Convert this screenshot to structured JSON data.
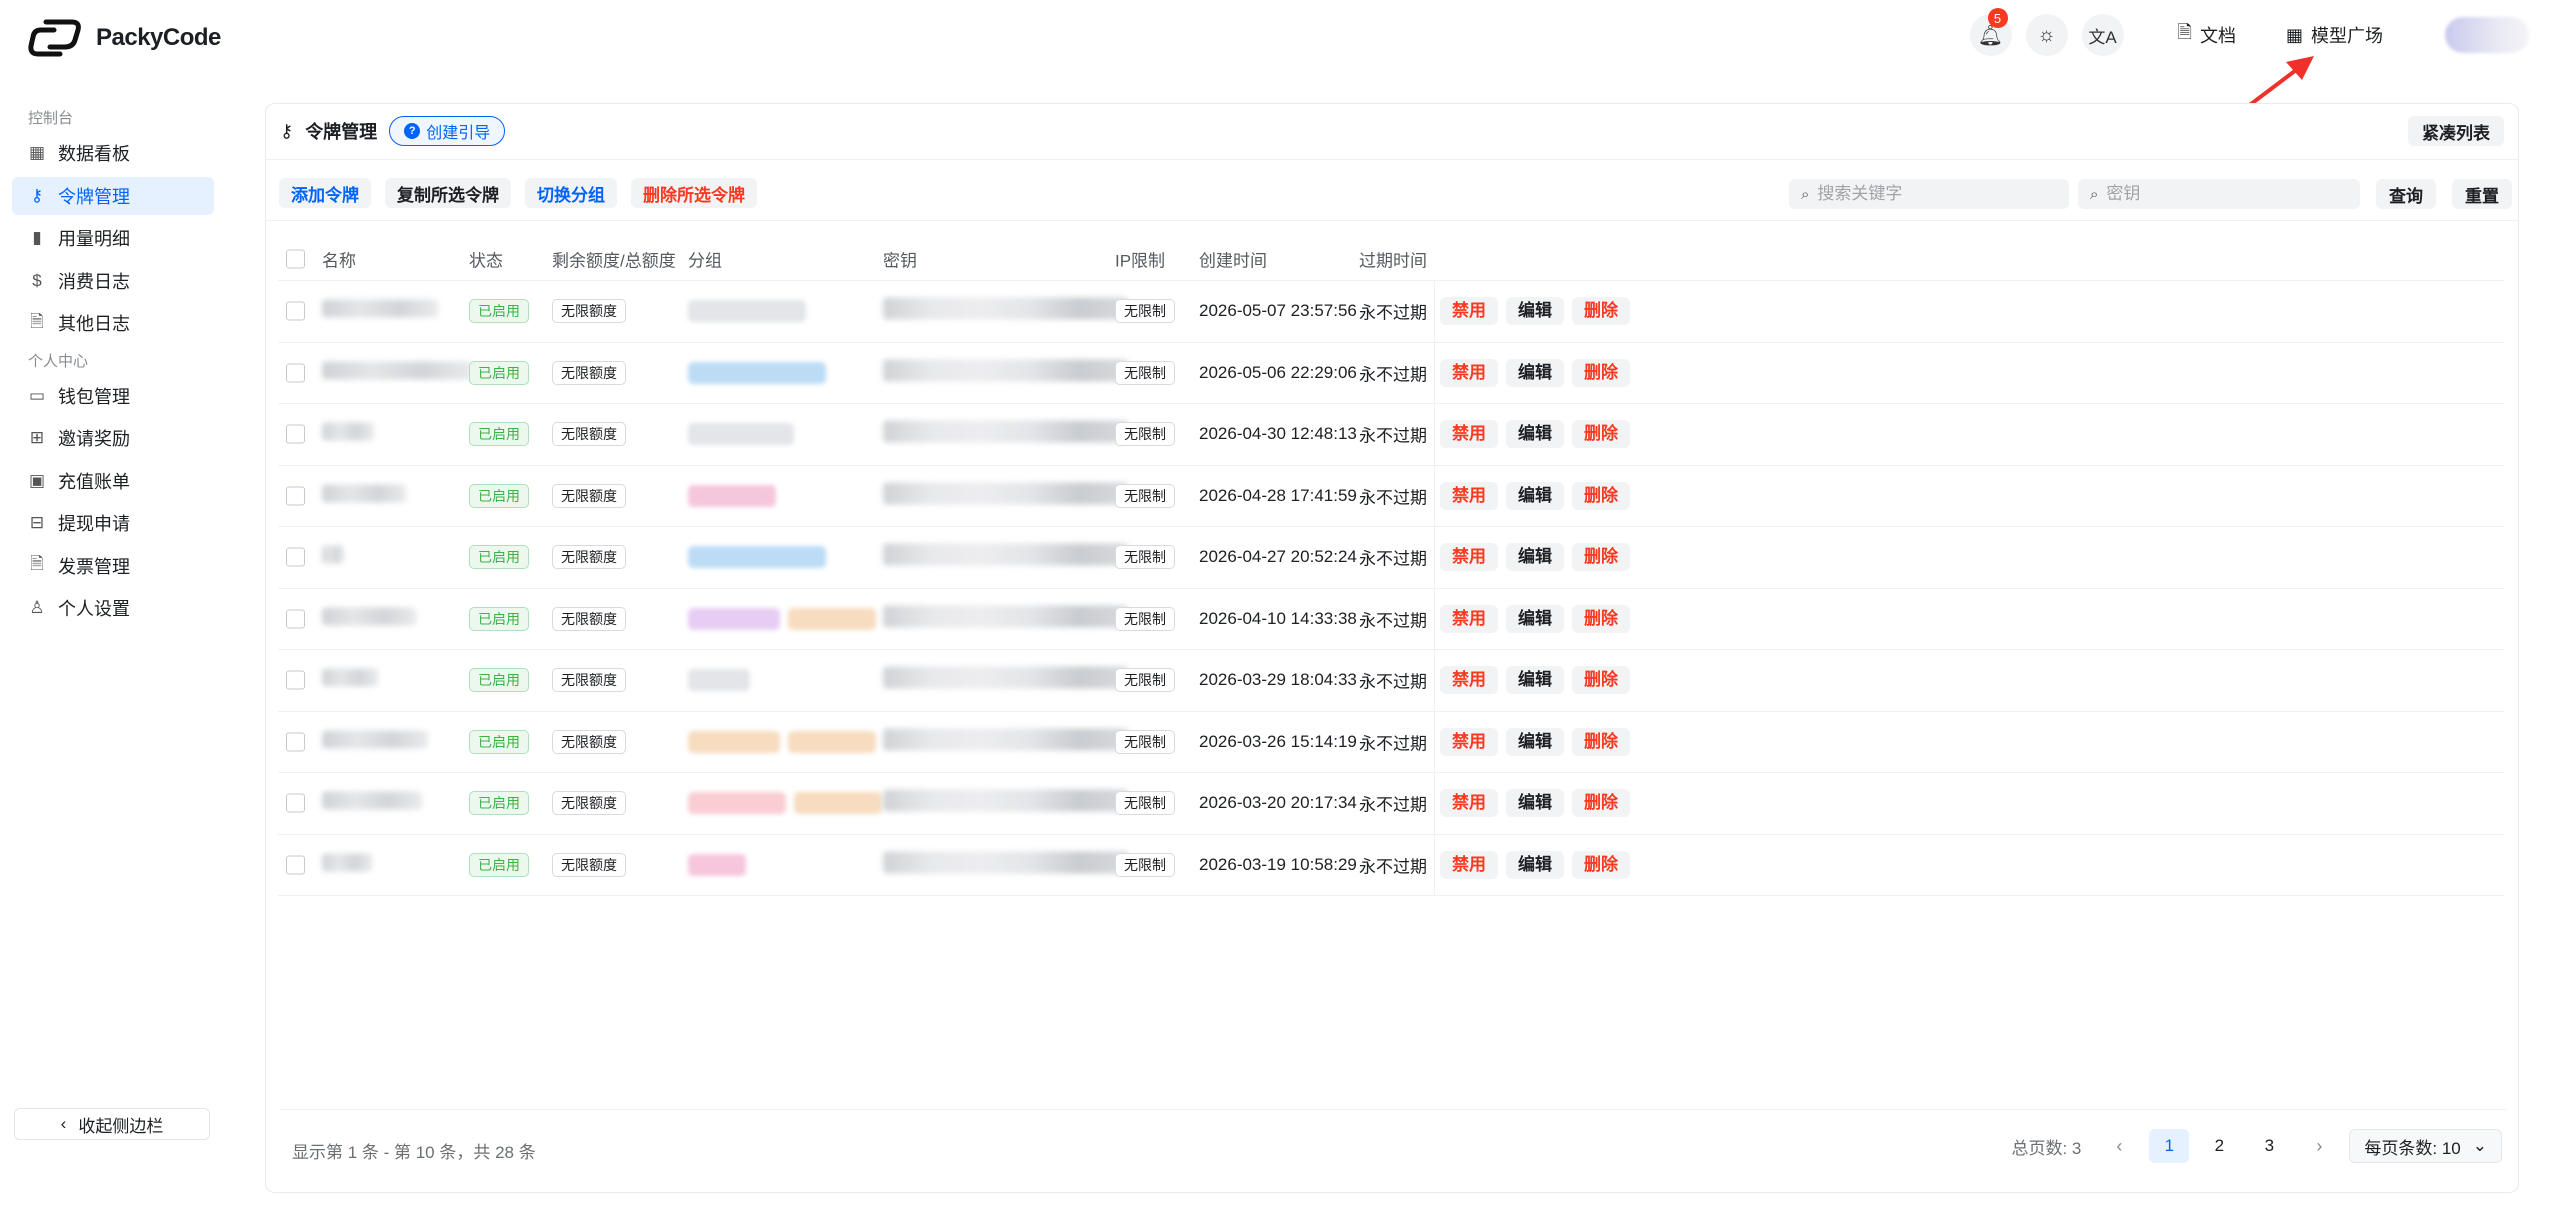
{
  "header": {
    "logo_text": "PackyCode",
    "notification_count": "5",
    "docs_label": "文档",
    "models_label": "模型广场",
    "brand_color": "#0064fa"
  },
  "sidebar": {
    "section1": "控制台",
    "section2": "个人中心",
    "items": [
      {
        "label": "数据看板",
        "icon": "dashboard-icon"
      },
      {
        "label": "令牌管理",
        "icon": "key-icon"
      },
      {
        "label": "用量明细",
        "icon": "bar-chart-icon"
      },
      {
        "label": "消费日志",
        "icon": "receipt-icon"
      },
      {
        "label": "其他日志",
        "icon": "document-icon"
      },
      {
        "label": "钱包管理",
        "icon": "wallet-icon"
      },
      {
        "label": "邀请奖励",
        "icon": "gift-icon"
      },
      {
        "label": "充值账单",
        "icon": "calendar-icon"
      },
      {
        "label": "提现申请",
        "icon": "cash-icon"
      },
      {
        "label": "发票管理",
        "icon": "invoice-icon"
      },
      {
        "label": "个人设置",
        "icon": "user-icon"
      }
    ],
    "collapse_label": "收起侧边栏"
  },
  "page": {
    "title": "令牌管理",
    "guide_label": "创建引导",
    "compact_label": "紧凑列表",
    "actions": {
      "add": "添加令牌",
      "copy": "复制所选令牌",
      "switch_group": "切换分组",
      "delete_selected": "删除所选令牌"
    },
    "search": {
      "keyword_placeholder": "搜索关键字",
      "key_placeholder": "密钥",
      "query_label": "查询",
      "reset_label": "重置"
    }
  },
  "table": {
    "columns": [
      "名称",
      "状态",
      "剩余额度/总额度",
      "分组",
      "密钥",
      "IP限制",
      "创建时间",
      "过期时间"
    ],
    "rows": [
      {
        "status": "已启用",
        "quota": "无限额度",
        "ip": "无限制",
        "created": "2026-05-07 23:57:56",
        "expires": "永不过期"
      },
      {
        "status": "已启用",
        "quota": "无限额度",
        "ip": "无限制",
        "created": "2026-05-06 22:29:06",
        "expires": "永不过期"
      },
      {
        "status": "已启用",
        "quota": "无限额度",
        "ip": "无限制",
        "created": "2026-04-30 12:48:13",
        "expires": "永不过期"
      },
      {
        "status": "已启用",
        "quota": "无限额度",
        "ip": "无限制",
        "created": "2026-04-28 17:41:59",
        "expires": "永不过期"
      },
      {
        "status": "已启用",
        "quota": "无限额度",
        "ip": "无限制",
        "created": "2026-04-27 20:52:24",
        "expires": "永不过期"
      },
      {
        "status": "已启用",
        "quota": "无限额度",
        "ip": "无限制",
        "created": "2026-04-10 14:33:38",
        "expires": "永不过期"
      },
      {
        "status": "已启用",
        "quota": "无限额度",
        "ip": "无限制",
        "created": "2026-03-29 18:04:33",
        "expires": "永不过期"
      },
      {
        "status": "已启用",
        "quota": "无限额度",
        "ip": "无限制",
        "created": "2026-03-26 15:14:19",
        "expires": "永不过期"
      },
      {
        "status": "已启用",
        "quota": "无限额度",
        "ip": "无限制",
        "created": "2026-03-20 20:17:34",
        "expires": "永不过期"
      },
      {
        "status": "已启用",
        "quota": "无限额度",
        "ip": "无限制",
        "created": "2026-03-19 10:58:29",
        "expires": "永不过期"
      }
    ],
    "op_disable": "禁用",
    "op_edit": "编辑",
    "op_delete": "删除"
  },
  "footer": {
    "range_info": "显示第 1 条 - 第 10 条，共 28 条",
    "total_pages_label": "总页数: 3",
    "pages": [
      "1",
      "2",
      "3"
    ],
    "per_page_label": "每页条数: 10"
  }
}
